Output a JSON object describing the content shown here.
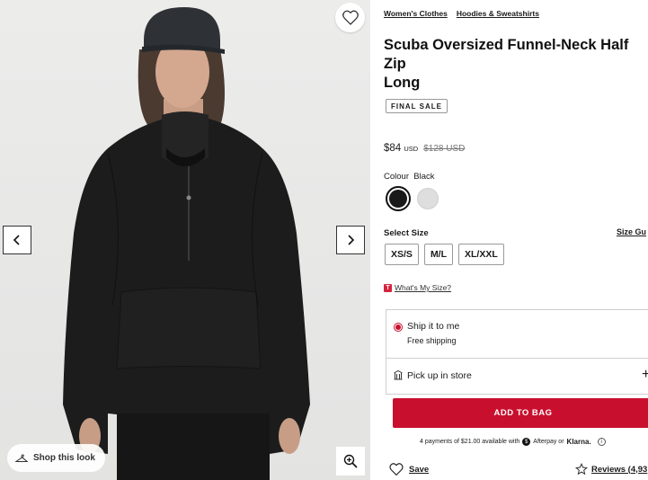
{
  "gallery": {
    "shop_look_label": "Shop this look",
    "icons": [
      "heart-icon",
      "chevron-left-icon",
      "chevron-right-icon",
      "hanger-icon",
      "zoom-in-icon"
    ]
  },
  "breadcrumb": [
    "Women's Clothes",
    "Hoodies & Sweatshirts"
  ],
  "product": {
    "title_line1": "Scuba Oversized Funnel-Neck Half Zip",
    "title_line2": "Long",
    "badge": "FINAL SALE",
    "price": "$84",
    "price_currency": "USD",
    "original_price": "$128 USD"
  },
  "colour": {
    "label": "Colour",
    "selected": "Black",
    "swatches": [
      {
        "name": "Black",
        "hex": "#1a1a1a"
      },
      {
        "name": "",
        "hex": "#dedede"
      }
    ]
  },
  "size": {
    "label": "Select Size",
    "guide": "Size Gu",
    "options": [
      "XS/S",
      "M/L",
      "XL/XXL"
    ],
    "whats_my_size": "What's My Size?"
  },
  "fulfilment": {
    "ship_title": "Ship it to me",
    "ship_sub": "Free shipping",
    "pickup_label": "Pick up in store",
    "plus": "+"
  },
  "cart": {
    "add_to_bag": "ADD TO BAG",
    "installments_text": "4 payments of $21.00 available with",
    "afterpay": "Afterpay or",
    "klarna": "Klarna."
  },
  "actions": {
    "save": "Save",
    "reviews": "Reviews (4,93"
  },
  "colors": {
    "accent": "#c8102e",
    "badge_red": "#d6233d"
  }
}
